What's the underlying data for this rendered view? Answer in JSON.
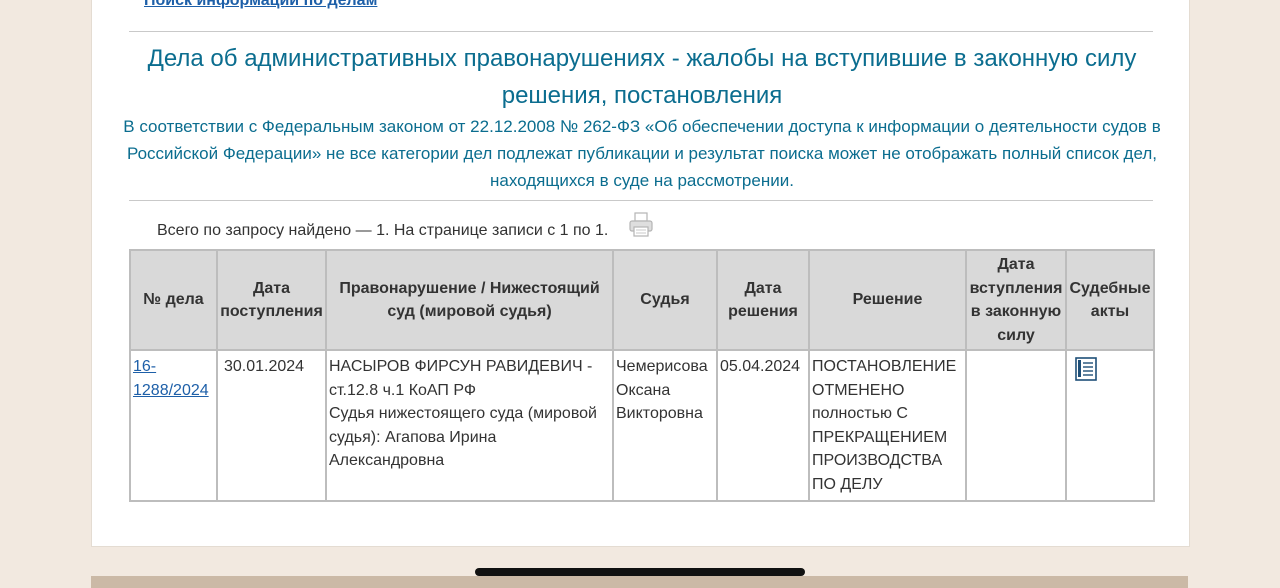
{
  "header": {
    "top_link": "Поиск информации по делам",
    "title": "Дела об административных правонарушениях - жалобы на вступившие в законную силу решения, постановления",
    "notice": "В соответствии с Федеральным законом от 22.12.2008 № 262-ФЗ «Об обеспечении доступа к информации о деятельности судов в Российской Федерации» не все категории дел подлежат публикации и результат поиска может не отображать полный список дел, находящихся в суде на рассмотрении."
  },
  "results": {
    "summary": "Всего по запросу найдено — 1. На странице записи с 1 по 1."
  },
  "table": {
    "columns": [
      "№ дела",
      "Дата поступления",
      "Правонарушение / Нижестоящий суд (мировой судья)",
      "Судья",
      "Дата решения",
      "Решение",
      "Дата вступления в законную силу",
      "Судебные акты"
    ],
    "rows": [
      {
        "case_number": "16-1288/2024",
        "received_date": "30.01.2024",
        "offense_line1": "НАСЫРОВ ФИРСУН РАВИДЕВИЧ - ст.12.8 ч.1 КоАП РФ",
        "offense_line2": "Судья нижестоящего суда (мировой судья): Агапова Ирина Александровна",
        "judge": "Чемерисова Оксана Викторовна",
        "decision_date": "05.04.2024",
        "decision": "ПОСТАНОВЛЕНИЕ ОТМЕНЕНО полностью С ПРЕКРАЩЕНИЕМ ПРОИЗВОДСТВА ПО ДЕЛУ",
        "effective_date": "",
        "acts_icon": "document-icon"
      }
    ]
  },
  "colors": {
    "title": "#0b6d8f",
    "link": "#1d5fa8",
    "header_bg": "#d9d9d9",
    "page_bg": "#f2e9e0"
  }
}
